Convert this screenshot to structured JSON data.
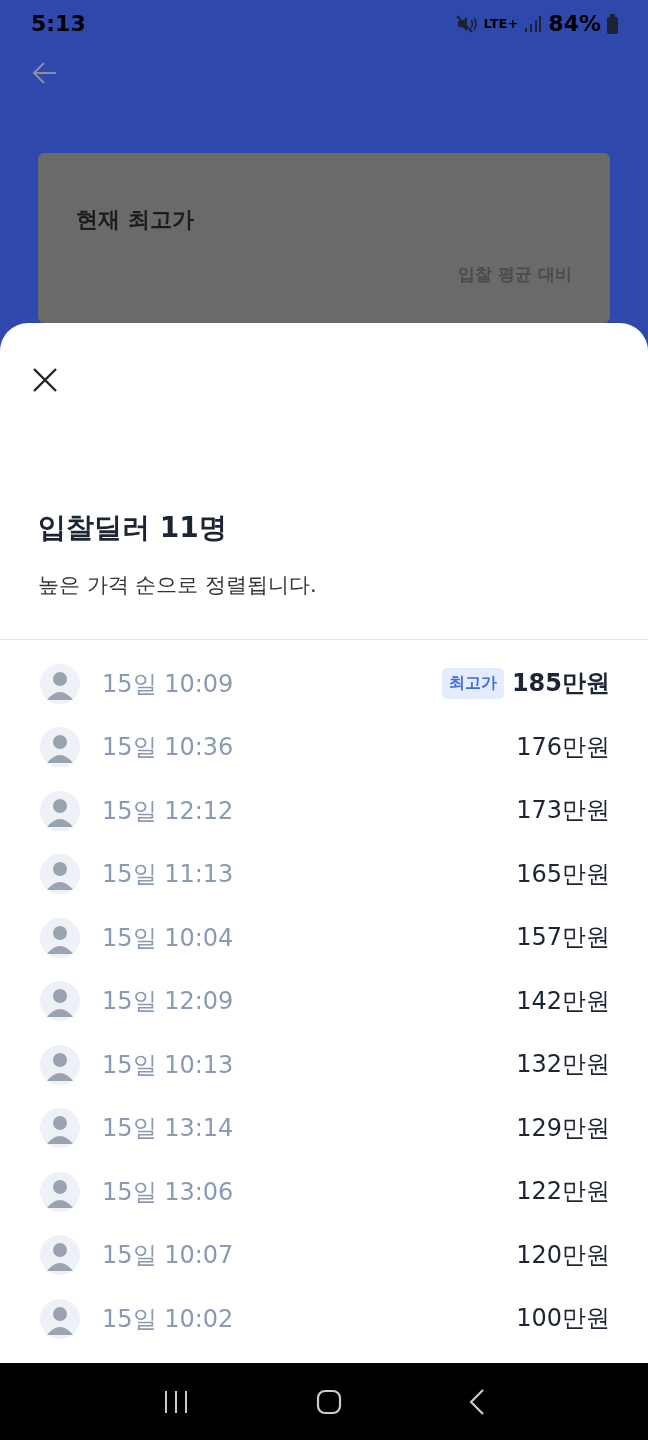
{
  "status_bar": {
    "time": "5:13",
    "network": "LTE+",
    "battery": "84%"
  },
  "card": {
    "title": "현재 최고가",
    "comparison_label": "입찰 평균 대비"
  },
  "sheet": {
    "title": "입찰딜러 11명",
    "subtitle": "높은 가격 순으로 정렬됩니다.",
    "dealers": [
      {
        "time": "15일 10:09",
        "price": "185만원",
        "top": true,
        "badge": "최고가"
      },
      {
        "time": "15일 10:36",
        "price": "176만원",
        "top": false
      },
      {
        "time": "15일 12:12",
        "price": "173만원",
        "top": false
      },
      {
        "time": "15일 11:13",
        "price": "165만원",
        "top": false
      },
      {
        "time": "15일 10:04",
        "price": "157만원",
        "top": false
      },
      {
        "time": "15일 12:09",
        "price": "142만원",
        "top": false
      },
      {
        "time": "15일 10:13",
        "price": "132만원",
        "top": false
      },
      {
        "time": "15일 13:14",
        "price": "129만원",
        "top": false
      },
      {
        "time": "15일 13:06",
        "price": "122만원",
        "top": false
      },
      {
        "time": "15일 10:07",
        "price": "120만원",
        "top": false
      },
      {
        "time": "15일 10:02",
        "price": "100만원",
        "top": false
      }
    ]
  }
}
